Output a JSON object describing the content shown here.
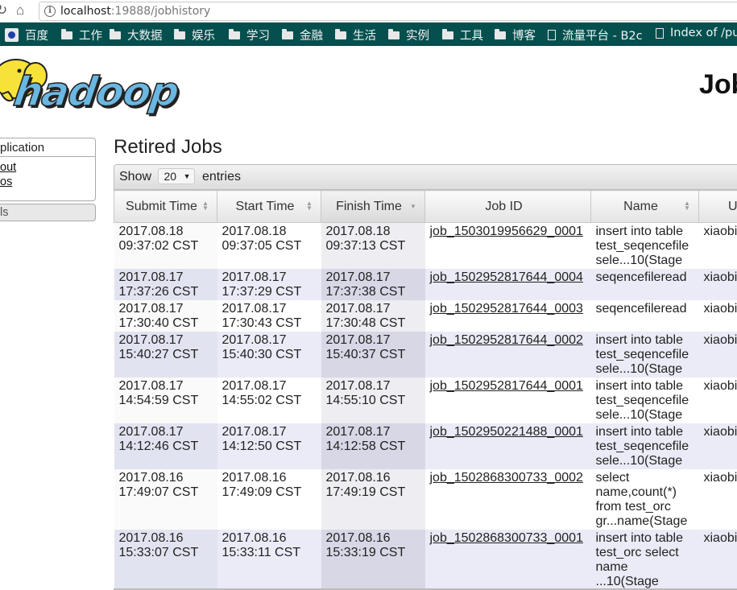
{
  "browser": {
    "url_host": "localhost",
    "url_rest": ":19888/jobhistory",
    "bookmarks": [
      {
        "label": "百度",
        "icon": "paw-icon"
      },
      {
        "label": "工作",
        "icon": "folder-icon"
      },
      {
        "label": "大数据",
        "icon": "folder-icon"
      },
      {
        "label": "娱乐",
        "icon": "folder-icon"
      },
      {
        "label": "学习",
        "icon": "folder-icon"
      },
      {
        "label": "金融",
        "icon": "folder-icon"
      },
      {
        "label": "生活",
        "icon": "folder-icon"
      },
      {
        "label": "实例",
        "icon": "folder-icon"
      },
      {
        "label": "工具",
        "icon": "folder-icon"
      },
      {
        "label": "博客",
        "icon": "folder-icon"
      },
      {
        "label": "流量平台 - B2c",
        "icon": "page-icon"
      },
      {
        "label": "Index of /pu",
        "icon": "page-icon"
      }
    ]
  },
  "header": {
    "logo_text": "hadoop",
    "title": "Job"
  },
  "sidebar": {
    "app_heading": "plication",
    "links": [
      "out",
      "os"
    ],
    "tools_label": "ls"
  },
  "main": {
    "heading": "Retired Jobs",
    "show_label": "Show",
    "entries_value": "20",
    "entries_label": "entries",
    "columns": [
      "Submit Time",
      "Start Time",
      "Finish Time",
      "Job ID",
      "Name",
      "U"
    ],
    "rows": [
      {
        "submit": [
          "2017.08.18",
          "09:37:02 CST"
        ],
        "start": [
          "2017.08.18",
          "09:37:05 CST"
        ],
        "finish": [
          "2017.08.18",
          "09:37:13 CST"
        ],
        "job_id": "job_1503019956629_0001",
        "name": [
          "insert into table",
          "test_seqencefile",
          "sele...10(Stage"
        ],
        "user": "xiaobi"
      },
      {
        "submit": [
          "2017.08.17",
          "17:37:26 CST"
        ],
        "start": [
          "2017.08.17",
          "17:37:29 CST"
        ],
        "finish": [
          "2017.08.17",
          "17:37:38 CST"
        ],
        "job_id": "job_1502952817644_0004",
        "name": [
          "seqencefileread"
        ],
        "user": "xiaobi"
      },
      {
        "submit": [
          "2017.08.17",
          "17:30:40 CST"
        ],
        "start": [
          "2017.08.17",
          "17:30:43 CST"
        ],
        "finish": [
          "2017.08.17",
          "17:30:48 CST"
        ],
        "job_id": "job_1502952817644_0003",
        "name": [
          "seqencefileread"
        ],
        "user": "xiaobi"
      },
      {
        "submit": [
          "2017.08.17",
          "15:40:27 CST"
        ],
        "start": [
          "2017.08.17",
          "15:40:30 CST"
        ],
        "finish": [
          "2017.08.17",
          "15:40:37 CST"
        ],
        "job_id": "job_1502952817644_0002",
        "name": [
          "insert into table",
          "test_seqencefile",
          "sele...10(Stage"
        ],
        "user": "xiaobi"
      },
      {
        "submit": [
          "2017.08.17",
          "14:54:59 CST"
        ],
        "start": [
          "2017.08.17",
          "14:55:02 CST"
        ],
        "finish": [
          "2017.08.17",
          "14:55:10 CST"
        ],
        "job_id": "job_1502952817644_0001",
        "name": [
          "insert into table",
          "test_seqencefile",
          "sele...10(Stage"
        ],
        "user": "xiaobi"
      },
      {
        "submit": [
          "2017.08.17",
          "14:12:46 CST"
        ],
        "start": [
          "2017.08.17",
          "14:12:50 CST"
        ],
        "finish": [
          "2017.08.17",
          "14:12:58 CST"
        ],
        "job_id": "job_1502950221488_0001",
        "name": [
          "insert into table",
          "test_seqencefile",
          "sele...10(Stage"
        ],
        "user": "xiaobi"
      },
      {
        "submit": [
          "2017.08.16",
          "17:49:07 CST"
        ],
        "start": [
          "2017.08.16",
          "17:49:09 CST"
        ],
        "finish": [
          "2017.08.16",
          "17:49:19 CST"
        ],
        "job_id": "job_1502868300733_0002",
        "name": [
          "select",
          "name,count(*)",
          "from test_orc",
          "gr...name(Stage"
        ],
        "user": "xiaobi"
      },
      {
        "submit": [
          "2017.08.16",
          "15:33:07 CST"
        ],
        "start": [
          "2017.08.16",
          "15:33:11 CST"
        ],
        "finish": [
          "2017.08.16",
          "15:33:19 CST"
        ],
        "job_id": "job_1502868300733_0001",
        "name": [
          "insert into table",
          "test_orc select",
          "name",
          "...10(Stage"
        ],
        "user": "xiaobi"
      }
    ]
  }
}
